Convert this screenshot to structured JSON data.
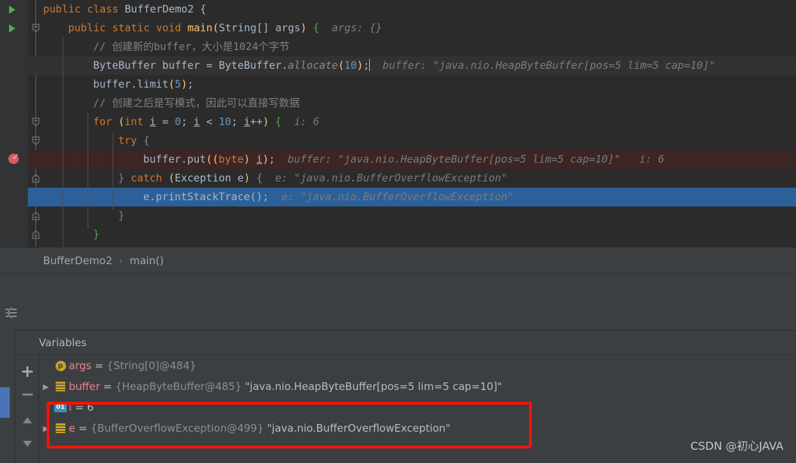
{
  "editor": {
    "lines": [
      {
        "indent": 0,
        "tokens": [
          {
            "t": "public",
            "c": "kw"
          },
          {
            "t": " ",
            "c": "punct"
          },
          {
            "t": "class",
            "c": "kw"
          },
          {
            "t": " ",
            "c": "punct"
          },
          {
            "t": "BufferDemo2",
            "c": "cls"
          },
          {
            "t": " ",
            "c": "punct"
          },
          {
            "t": "{",
            "c": "brace1"
          }
        ],
        "hint": ""
      },
      {
        "indent": 1,
        "tokens": [
          {
            "t": "public",
            "c": "kw"
          },
          {
            "t": " ",
            "c": "punct"
          },
          {
            "t": "static",
            "c": "kw"
          },
          {
            "t": " ",
            "c": "punct"
          },
          {
            "t": "void",
            "c": "kw"
          },
          {
            "t": " ",
            "c": "punct"
          },
          {
            "t": "main",
            "c": "fn"
          },
          {
            "t": "(",
            "c": "brace-y"
          },
          {
            "t": "String",
            "c": "cls"
          },
          {
            "t": "[] ",
            "c": "punct"
          },
          {
            "t": "args",
            "c": "cls"
          },
          {
            "t": ")",
            "c": "brace-y"
          },
          {
            "t": " ",
            "c": "punct"
          },
          {
            "t": "{",
            "c": "green-b"
          }
        ],
        "hint": "  args: {}"
      },
      {
        "indent": 2,
        "tokens": [
          {
            "t": "// 创建新的buffer，大小是1024个字节",
            "c": "com"
          }
        ],
        "hint": ""
      },
      {
        "indent": 2,
        "tokens": [
          {
            "t": "ByteBuffer",
            "c": "cls"
          },
          {
            "t": " buffer ",
            "c": "punct"
          },
          {
            "t": "=",
            "c": "punct"
          },
          {
            "t": " ByteBuffer",
            "c": "punct"
          },
          {
            "t": ".",
            "c": "punct"
          },
          {
            "t": "allocate",
            "c": "ital-m"
          },
          {
            "t": "(",
            "c": "brace-y"
          },
          {
            "t": "10",
            "c": "num"
          },
          {
            "t": ")",
            "c": "brace-y"
          },
          {
            "t": ";",
            "c": "punct"
          }
        ],
        "hint": "  buffer: \"java.nio.HeapByteBuffer[pos=5 lim=5 cap=10]\""
      },
      {
        "indent": 2,
        "tokens": [
          {
            "t": "buffer",
            "c": "punct"
          },
          {
            "t": ".",
            "c": "punct"
          },
          {
            "t": "limit",
            "c": "punct"
          },
          {
            "t": "(",
            "c": "brace-y"
          },
          {
            "t": "5",
            "c": "num"
          },
          {
            "t": ")",
            "c": "brace-y"
          },
          {
            "t": ";",
            "c": "punct"
          }
        ],
        "hint": ""
      },
      {
        "indent": 2,
        "tokens": [
          {
            "t": "// 创建之后是写模式，因此可以直接写数据",
            "c": "com"
          }
        ],
        "hint": ""
      },
      {
        "indent": 2,
        "tokens": [
          {
            "t": "for",
            "c": "kw"
          },
          {
            "t": " ",
            "c": "punct"
          },
          {
            "t": "(",
            "c": "brace-y"
          },
          {
            "t": "int",
            "c": "kw"
          },
          {
            "t": " ",
            "c": "punct"
          },
          {
            "t": "i",
            "c": "var-underline"
          },
          {
            "t": " = ",
            "c": "punct"
          },
          {
            "t": "0",
            "c": "num"
          },
          {
            "t": "; ",
            "c": "punct"
          },
          {
            "t": "i",
            "c": "var-underline"
          },
          {
            "t": " ",
            "c": "punct"
          },
          {
            "t": "<",
            "c": "punct"
          },
          {
            "t": " ",
            "c": "punct"
          },
          {
            "t": "10",
            "c": "num"
          },
          {
            "t": "; ",
            "c": "punct"
          },
          {
            "t": "i",
            "c": "var-underline"
          },
          {
            "t": "++",
            "c": "punct"
          },
          {
            "t": ")",
            "c": "brace-y"
          },
          {
            "t": " ",
            "c": "punct"
          },
          {
            "t": "{",
            "c": "green-b"
          }
        ],
        "hint": "  i: 6"
      },
      {
        "indent": 3,
        "tokens": [
          {
            "t": "try",
            "c": "kw"
          },
          {
            "t": " ",
            "c": "punct"
          },
          {
            "t": "{",
            "c": "purple-b"
          }
        ],
        "hint": ""
      },
      {
        "indent": 4,
        "tokens": [
          {
            "t": "buffer",
            "c": "punct"
          },
          {
            "t": ".",
            "c": "punct"
          },
          {
            "t": "put",
            "c": "punct"
          },
          {
            "t": "((",
            "c": "brace-y"
          },
          {
            "t": "byte",
            "c": "kw"
          },
          {
            "t": ") ",
            "c": "brace-y"
          },
          {
            "t": "i",
            "c": "var-underline"
          },
          {
            "t": ")",
            "c": "brace-y"
          },
          {
            "t": ";",
            "c": "punct"
          }
        ],
        "hint": "  buffer: \"java.nio.HeapByteBuffer[pos=5 lim=5 cap=10]\"   i: 6"
      },
      {
        "indent": 3,
        "tokens": [
          {
            "t": "}",
            "c": "purple-b"
          },
          {
            "t": " ",
            "c": "punct"
          },
          {
            "t": "catch",
            "c": "kw"
          },
          {
            "t": " ",
            "c": "punct"
          },
          {
            "t": "(",
            "c": "brace-y"
          },
          {
            "t": "Exception",
            "c": "cls"
          },
          {
            "t": " e",
            "c": "punct"
          },
          {
            "t": ")",
            "c": "brace-y"
          },
          {
            "t": " ",
            "c": "punct"
          },
          {
            "t": "{",
            "c": "purple-b"
          }
        ],
        "hint": "  e: \"java.nio.BufferOverflowException\""
      },
      {
        "indent": 4,
        "tokens": [
          {
            "t": "e",
            "c": "punct"
          },
          {
            "t": ".",
            "c": "punct"
          },
          {
            "t": "printStackTrace",
            "c": "punct"
          },
          {
            "t": "(",
            "c": "brace1"
          },
          {
            "t": ")",
            "c": "brace1"
          },
          {
            "t": ";",
            "c": "punct"
          }
        ],
        "hint": "  e: \"java.nio.BufferOverflowException\""
      },
      {
        "indent": 3,
        "tokens": [
          {
            "t": "}",
            "c": "purple-b"
          }
        ],
        "hint": ""
      },
      {
        "indent": 2,
        "tokens": [
          {
            "t": "}",
            "c": "green-b"
          }
        ],
        "hint": ""
      }
    ]
  },
  "breadcrumb": {
    "class": "BufferDemo2",
    "separator": "›",
    "method": "main()"
  },
  "debug": {
    "variables_title": "Variables",
    "toolbar": {
      "add": "+",
      "remove": "−",
      "up": "▲",
      "down": "▼"
    },
    "variables": [
      {
        "expander": "",
        "icon": "parameter-icon",
        "icon_text": "p",
        "name": "args",
        "eq": " = ",
        "ref": "{String[0]@484}",
        "value": "",
        "highlighted": false
      },
      {
        "expander": "▶",
        "icon": "object-icon",
        "icon_text": "",
        "name": "buffer",
        "eq": " = ",
        "ref": "{HeapByteBuffer@485}",
        "value": " \"java.nio.HeapByteBuffer[pos=5 lim=5 cap=10]\"",
        "highlighted": false
      },
      {
        "expander": "",
        "icon": "primitive-icon",
        "icon_text": "01",
        "name": "i",
        "eq": " = ",
        "ref": "",
        "value": "6",
        "highlighted": true
      },
      {
        "expander": "▶",
        "icon": "object-icon",
        "icon_text": "",
        "name": "e",
        "eq": " = ",
        "ref": "{BufferOverflowException@499}",
        "value": " \"java.nio.BufferOverflowException\"",
        "highlighted": true
      }
    ]
  },
  "watermark": {
    "text": "CSDN @初心JAVA"
  },
  "colors": {
    "editor_bg": "#2b2b2b",
    "gutter_bg": "#313335",
    "panel_bg": "#3c3f41",
    "selected_line": "#2d6099",
    "exception_line": "#3c2525",
    "breakpoint": "#db5860",
    "run_arrow": "#4caf50",
    "annotation_red": "#fc1203",
    "keyword": "#cc7832",
    "number": "#6897bb",
    "comment": "#808080",
    "method": "#ffc66d",
    "var_name": "#e8838f",
    "hint_text": "#777c80"
  }
}
